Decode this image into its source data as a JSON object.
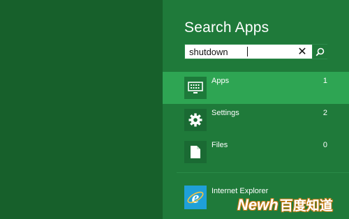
{
  "panel": {
    "title": "Search Apps"
  },
  "search": {
    "value": "shutdown",
    "placeholder": "",
    "clear_icon": "close-icon",
    "search_icon": "search-icon"
  },
  "categories": [
    {
      "label": "Apps",
      "count": "1",
      "icon": "apps-keyboard-icon",
      "selected": true
    },
    {
      "label": "Settings",
      "count": "2",
      "icon": "gear-icon",
      "selected": false
    },
    {
      "label": "Files",
      "count": "0",
      "icon": "file-icon",
      "selected": false
    }
  ],
  "results": [
    {
      "label": "Internet Explorer",
      "icon": "internet-explorer-icon"
    }
  ],
  "watermark": {
    "brand": "Newh",
    "chinese": "百度知道"
  },
  "colors": {
    "background": "#17602b",
    "panel": "#1f7a3a",
    "selected": "#2ea553",
    "ie_tile": "#1fa0d8"
  }
}
